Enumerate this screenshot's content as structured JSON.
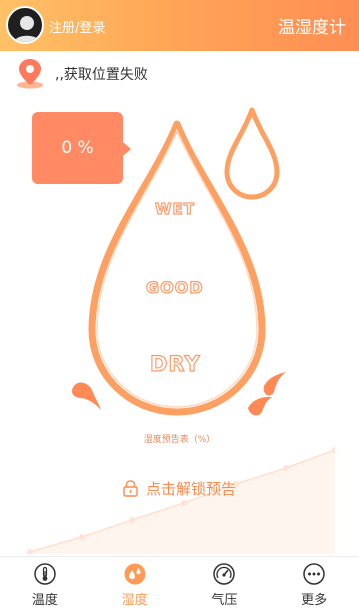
{
  "header": {
    "login_label": "注册/登录",
    "title": "温湿度计"
  },
  "location": {
    "status_text": ",,获取位置失败"
  },
  "humidity": {
    "percent_text": "0 %",
    "labels": {
      "wet": "WET",
      "good": "GOOD",
      "dry": "DRY"
    }
  },
  "forecast": {
    "caption": "湿度预告表（%）",
    "unlock_label": "点击解锁预告"
  },
  "tabs": [
    {
      "label": "温度",
      "icon": "thermometer-icon",
      "active": false
    },
    {
      "label": "湿度",
      "icon": "droplets-icon",
      "active": true
    },
    {
      "label": "气压",
      "icon": "gauge-icon",
      "active": false
    },
    {
      "label": "更多",
      "icon": "more-icon",
      "active": false
    }
  ],
  "colors": {
    "accent": "#ff9a57",
    "header_start": "#ffc166",
    "header_end": "#ff8e54",
    "percent_box": "#ff8a63",
    "drop_stroke": "#ffa063"
  }
}
